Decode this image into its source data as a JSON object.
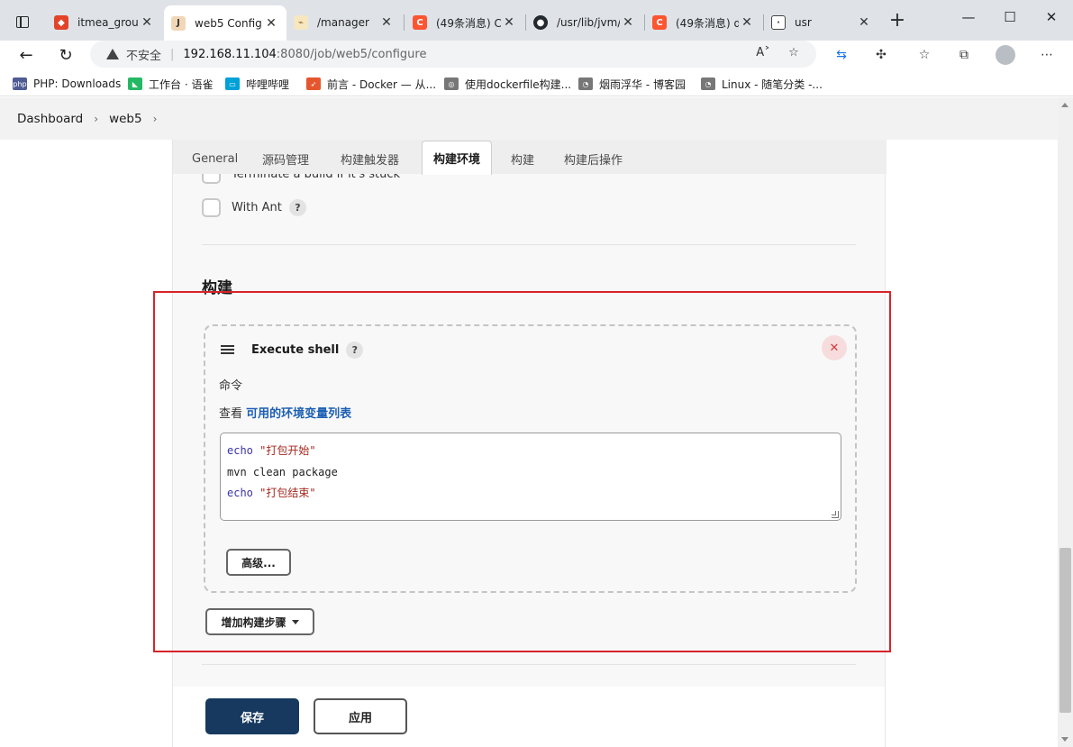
{
  "browser": {
    "tabs": [
      {
        "label": "itmea_group",
        "icon": "gitlab-icon",
        "color": "#e24329"
      },
      {
        "label": "web5 Config",
        "icon": "jenkins-icon",
        "color": "#d24939"
      },
      {
        "label": "/manager",
        "icon": "tomcat-icon",
        "color": "#9b6b2c"
      },
      {
        "label": "(49条消息) C",
        "icon": "csdn-icon",
        "color": "#fc5531"
      },
      {
        "label": "/usr/lib/jvm/",
        "icon": "github-icon",
        "color": "#24292e"
      },
      {
        "label": "(49条消息) d",
        "icon": "csdn-icon",
        "color": "#fc5531"
      },
      {
        "label": "usr",
        "icon": "file-icon",
        "color": "#555555"
      }
    ],
    "address": {
      "security_label": "不安全",
      "host": "192.168.11.104",
      "path": ":8080/job/web5/configure"
    },
    "bookmarks": [
      {
        "label": "PHP: Downloads",
        "icon": "php-icon",
        "color": "#4f5b93"
      },
      {
        "label": "工作台 · 语雀",
        "icon": "yuque-icon",
        "color": "#25b864"
      },
      {
        "label": "哔哩哔哩",
        "icon": "bilibili-icon",
        "color": "#00a1d6"
      },
      {
        "label": "前言 - Docker — 从...",
        "icon": "rocket-icon",
        "color": "#e4572e"
      },
      {
        "label": "使用dockerfile构建...",
        "icon": "globe-icon",
        "color": "#555555"
      },
      {
        "label": "烟雨浮华 - 博客园",
        "icon": "cnblogs-icon",
        "color": "#555555"
      },
      {
        "label": "Linux - 随笔分类 -...",
        "icon": "cnblogs-icon",
        "color": "#555555"
      }
    ]
  },
  "breadcrumb": {
    "items": [
      "Dashboard",
      "web5"
    ]
  },
  "config_tabs": [
    "General",
    "源码管理",
    "构建触发器",
    "构建环境",
    "构建",
    "构建后操作"
  ],
  "env_options": {
    "partial_label": "Terminate a build if it's stuck",
    "with_ant_label": "With Ant",
    "help_glyph": "?"
  },
  "build": {
    "section_title": "构建",
    "step_title": "Execute shell",
    "command_label": "命令",
    "env_prefix": "查看 ",
    "env_link": "可用的环境变量列表",
    "script": {
      "line1_kw": "echo",
      "line1_str": "\"打包开始\"",
      "line2": "mvn clean package",
      "line3_kw": "echo",
      "line3_str": "\"打包结束\""
    },
    "advanced_label": "高级...",
    "add_step_label": "增加构建步骤"
  },
  "footer": {
    "save_label": "保存",
    "apply_label": "应用"
  },
  "colors": {
    "save_bg": "#17395f",
    "highlight_border": "#d8232a",
    "link": "#1d5fb4"
  }
}
